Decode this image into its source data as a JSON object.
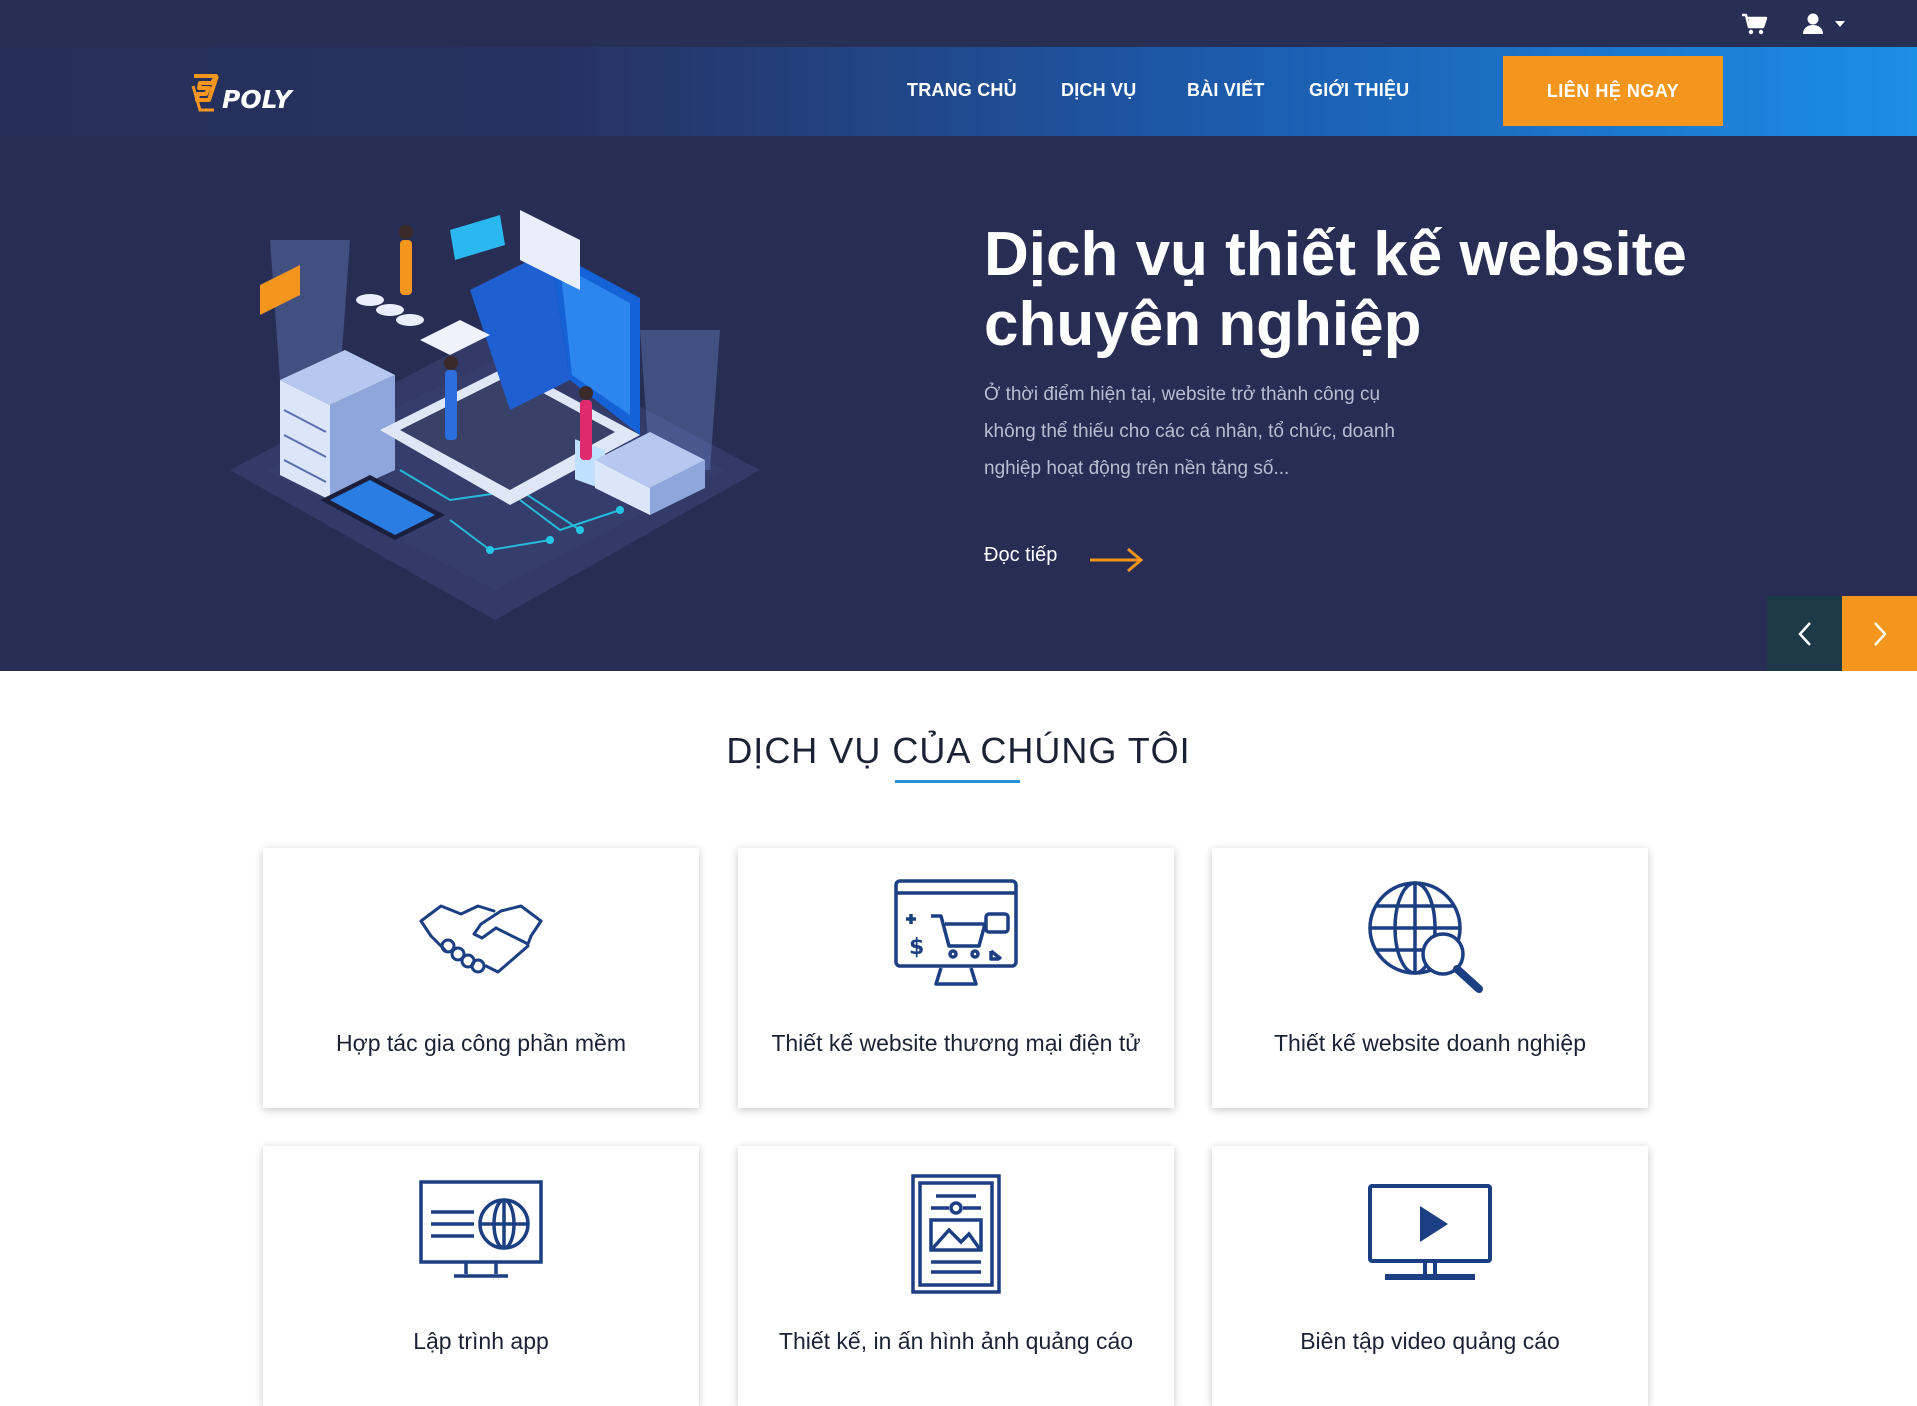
{
  "topbar": {
    "cart_icon": "cart-icon",
    "user_icon": "user-icon"
  },
  "navbar": {
    "logo_text": "POLY",
    "items": [
      {
        "label": "TRANG CHỦ"
      },
      {
        "label": "DỊCH VỤ"
      },
      {
        "label": "BÀI VIẾT"
      },
      {
        "label": "GIỚI THIỆU"
      }
    ],
    "cta_label": "LIÊN HỆ NGAY"
  },
  "hero": {
    "title_line1": "Dịch vụ thiết kế website",
    "title_line2": "chuyên nghiệp",
    "desc_line1": "Ở thời điểm hiện tại, website trở thành công cụ",
    "desc_line2": "không thể thiếu cho các cá nhân, tổ chức, doanh",
    "desc_line3": "nghiệp hoạt động trên nền tảng số...",
    "read_more": "Đọc tiếp"
  },
  "services": {
    "title": "DỊCH VỤ CỦA CHÚNG TÔI",
    "items": [
      {
        "label": "Hợp tác gia công phần mềm",
        "icon": "handshake-icon"
      },
      {
        "label": "Thiết kế website thương mại điện tử",
        "icon": "ecommerce-icon"
      },
      {
        "label": "Thiết kế website doanh nghiệp",
        "icon": "globe-search-icon"
      },
      {
        "label": "Lập trình app",
        "icon": "monitor-globe-icon"
      },
      {
        "label": "Thiết kế, in ấn hình ảnh quảng cáo",
        "icon": "print-document-icon"
      },
      {
        "label": "Biên tập video quảng cáo",
        "icon": "video-play-icon"
      }
    ]
  },
  "colors": {
    "navy": "#282d54",
    "orange": "#f4961e",
    "icon_blue": "#1b3f82",
    "accent_blue": "#2a8fd9"
  }
}
